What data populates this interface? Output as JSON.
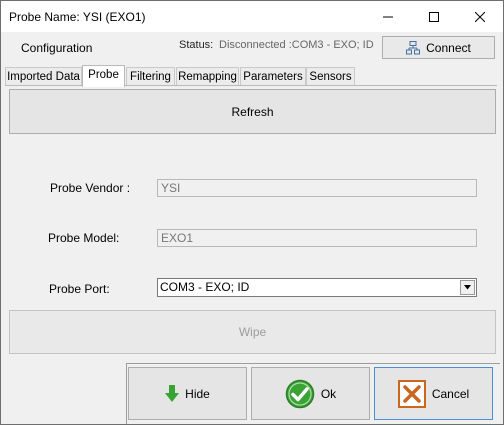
{
  "window": {
    "title": "Probe Name: YSI (EXO1)"
  },
  "header": {
    "configuration_label": "Configuration",
    "status_label": "Status:",
    "status_value": "Disconnected :COM3 - EXO; ID",
    "connect_label": "Connect"
  },
  "tabs": [
    {
      "label": "Imported Data",
      "active": false
    },
    {
      "label": "Probe",
      "active": true
    },
    {
      "label": "Filtering",
      "active": false
    },
    {
      "label": "Remapping",
      "active": false
    },
    {
      "label": "Parameters",
      "active": false
    },
    {
      "label": "Sensors",
      "active": false
    }
  ],
  "probe": {
    "refresh_label": "Refresh",
    "vendor_label": "Probe Vendor :",
    "vendor_value": "YSI",
    "model_label": "Probe Model:",
    "model_value": "EXO1",
    "port_label": "Probe Port:",
    "port_value": "COM3 - EXO; ID",
    "wipe_label": "Wipe"
  },
  "footer": {
    "hide_label": "Hide",
    "ok_label": "Ok",
    "cancel_label": "Cancel"
  },
  "colors": {
    "hide_arrow": "#3aa335",
    "ok_check": "#3aa335",
    "cancel_x": "#c9661f",
    "cancel_border": "#4a90d9"
  },
  "icons": {
    "connect": "network-icon",
    "hide": "down-arrow-icon",
    "ok": "check-circle-icon",
    "cancel": "x-box-icon",
    "minimize": "minimize-icon",
    "maximize": "maximize-icon",
    "close": "close-icon",
    "dropdown": "chevron-down-icon"
  }
}
